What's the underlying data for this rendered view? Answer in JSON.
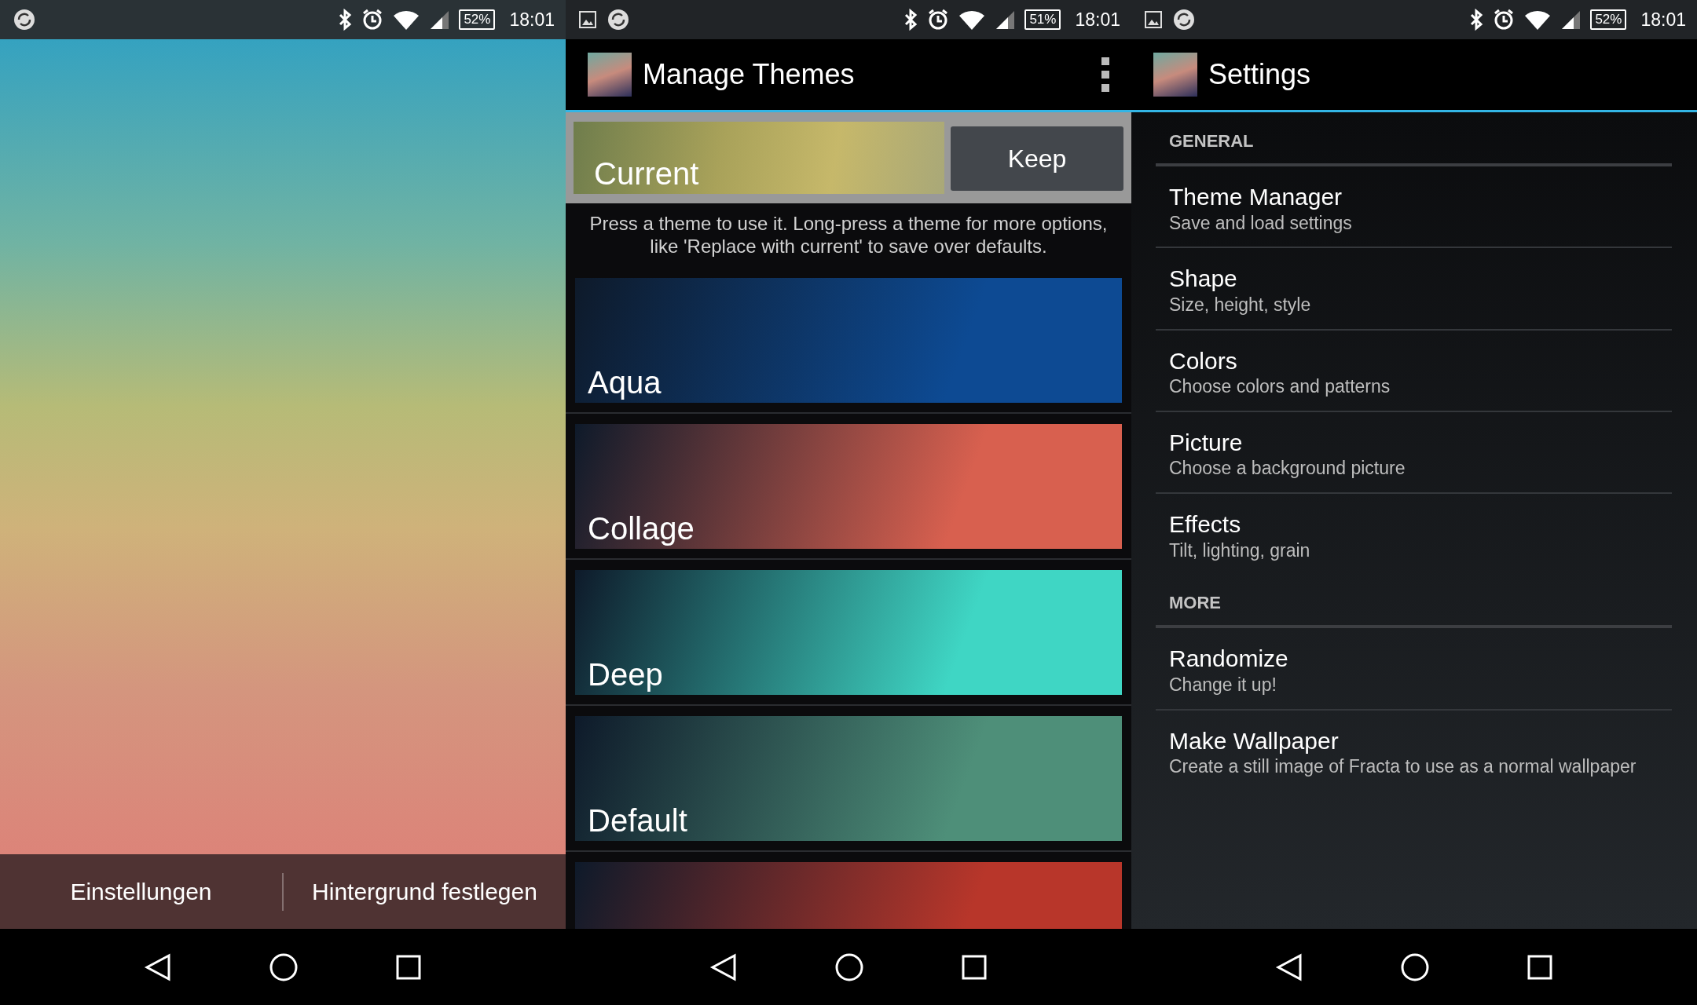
{
  "screens": [
    {
      "kind": "wallpaper",
      "status_bar": {
        "notification_icons": [
          {
            "kind": "sync"
          }
        ],
        "battery": "52%",
        "time": "18:01"
      },
      "buttons": [
        "Einstellungen",
        "Hintergrund festlegen"
      ]
    },
    {
      "kind": "themes",
      "status_bar": {
        "notification_icons": [
          {
            "kind": "image"
          },
          {
            "kind": "sync"
          }
        ],
        "battery": "51%",
        "time": "18:01"
      },
      "title": "Manage Themes",
      "current": {
        "label": "Current",
        "button": "Keep"
      },
      "hint": "Press a theme to use it.  Long-press a theme for more options, like 'Replace with current' to save over defaults.",
      "themes": [
        {
          "label": "Aqua",
          "color": "#0d4a93"
        },
        {
          "label": "Collage",
          "color": "#d8604f"
        },
        {
          "label": "Deep",
          "color": "#3fd6c4"
        },
        {
          "label": "Default",
          "color": "#4e8f79"
        },
        {
          "color": "#b8362a"
        }
      ]
    },
    {
      "kind": "settings",
      "status_bar": {
        "notification_icons": [
          {
            "kind": "image"
          },
          {
            "kind": "sync"
          }
        ],
        "battery": "52%",
        "time": "18:01"
      },
      "title": "Settings",
      "sections": [
        {
          "header": "GENERAL",
          "items": [
            {
              "title": "Theme Manager",
              "summary": "Save and load settings"
            },
            {
              "title": "Shape",
              "summary": "Size, height, style"
            },
            {
              "title": "Colors",
              "summary": "Choose colors and patterns"
            },
            {
              "title": "Picture",
              "summary": "Choose a background picture"
            },
            {
              "title": "Effects",
              "summary": "Tilt, lighting, grain"
            }
          ]
        },
        {
          "header": "MORE",
          "items": [
            {
              "title": "Randomize",
              "summary": "Change it up!"
            },
            {
              "title": "Make Wallpaper",
              "summary": "Create a still image of Fracta to use as a normal wallpaper"
            }
          ]
        }
      ]
    }
  ]
}
